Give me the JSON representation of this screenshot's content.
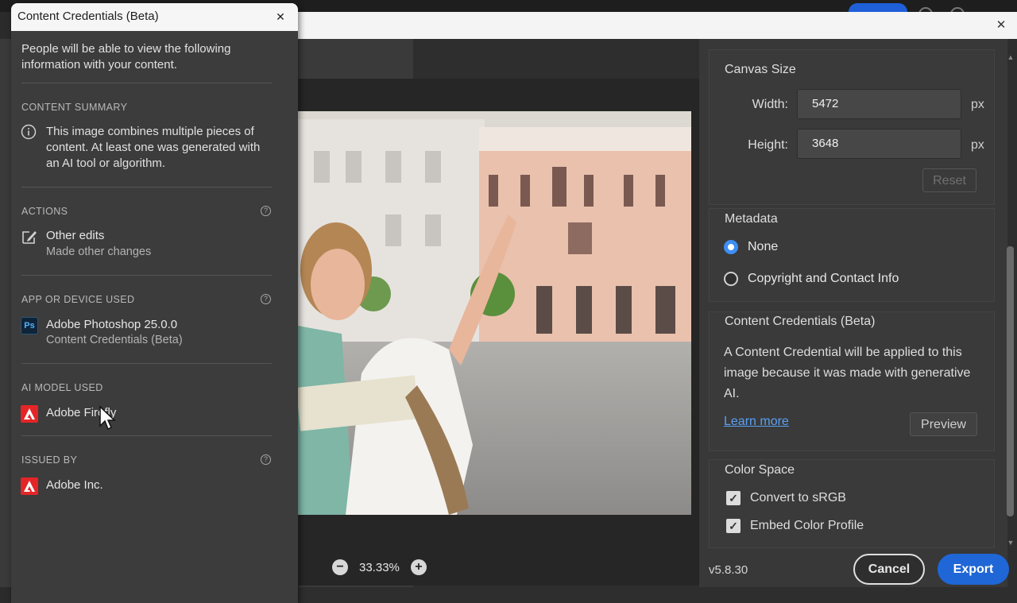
{
  "popup": {
    "title": "Content Credentials (Beta)",
    "intro": "People will be able to view the following information with your content.",
    "summary": {
      "heading": "CONTENT SUMMARY",
      "text": "This image combines multiple pieces of content. At least one was generated with an AI tool or algorithm."
    },
    "actions": {
      "heading": "ACTIONS",
      "item_title": "Other edits",
      "item_sub": "Made other changes"
    },
    "app": {
      "heading": "APP OR DEVICE USED",
      "icon_text": "Ps",
      "item_title": "Adobe Photoshop 25.0.0",
      "item_sub": "Content Credentials (Beta)"
    },
    "ai_model": {
      "heading": "AI MODEL USED",
      "item_title": "Adobe Firefly"
    },
    "issued_by": {
      "heading": "ISSUED BY",
      "item_title": "Adobe Inc."
    }
  },
  "preview": {
    "zoom_level": "33.33%"
  },
  "settings": {
    "canvas": {
      "title": "Canvas Size",
      "width_label": "Width:",
      "width_value": "5472",
      "height_label": "Height:",
      "height_value": "3648",
      "unit": "px",
      "reset_label": "Reset"
    },
    "metadata": {
      "title": "Metadata",
      "options": [
        "None",
        "Copyright and Contact Info"
      ],
      "selected": "None"
    },
    "credentials": {
      "title": "Content Credentials (Beta)",
      "text": "A Content Credential will be applied to this image because it was made with generative AI.",
      "learn_more": "Learn more",
      "preview_label": "Preview"
    },
    "color_space": {
      "title": "Color Space",
      "convert_label": "Convert to sRGB",
      "embed_label": "Embed Color Profile"
    }
  },
  "footer": {
    "version": "v5.8.30",
    "cancel_label": "Cancel",
    "export_label": "Export"
  },
  "colors": {
    "accent": "#1f66d6",
    "link": "#5aa0f2",
    "adobe_red": "#e42527"
  }
}
